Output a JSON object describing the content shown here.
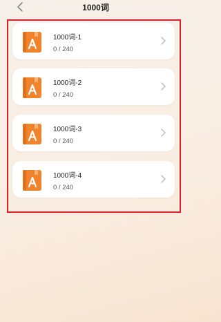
{
  "header": {
    "title": "1000词"
  },
  "lists": [
    {
      "name": "1000词-1",
      "progress": "0 / 240"
    },
    {
      "name": "1000词-2",
      "progress": "0 / 240"
    },
    {
      "name": "1000词-3",
      "progress": "0 / 240"
    },
    {
      "name": "1000词-4",
      "progress": "0 / 240"
    }
  ],
  "colors": {
    "book": "#f0832b",
    "highlight_border": "#d8232a"
  },
  "icons": [
    "back-arrow-icon",
    "book-icon",
    "chevron-right-icon"
  ]
}
